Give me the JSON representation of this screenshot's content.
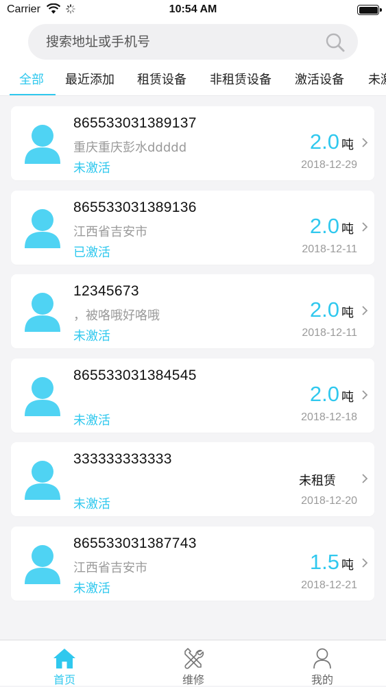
{
  "status_bar": {
    "carrier": "Carrier",
    "time": "10:54 AM"
  },
  "search": {
    "placeholder": "搜索地址或手机号"
  },
  "tabs": [
    {
      "label": "全部",
      "active": true
    },
    {
      "label": "最近添加",
      "active": false
    },
    {
      "label": "租赁设备",
      "active": false
    },
    {
      "label": "非租赁设备",
      "active": false
    },
    {
      "label": "激活设备",
      "active": false
    },
    {
      "label": "未激",
      "active": false
    }
  ],
  "devices": [
    {
      "id": "865533031389137",
      "address": "重庆重庆彭水ddddd",
      "status": "未激活",
      "weight": "2.0",
      "unit": "吨",
      "date": "2018-12-29"
    },
    {
      "id": "865533031389136",
      "address": "江西省吉安市",
      "status": "已激活",
      "weight": "2.0",
      "unit": "吨",
      "date": "2018-12-11"
    },
    {
      "id": "12345673",
      "address": "，被咯哦好咯哦",
      "status": "未激活",
      "weight": "2.0",
      "unit": "吨",
      "date": "2018-12-11"
    },
    {
      "id": "865533031384545",
      "address": "",
      "status": "未激活",
      "weight": "2.0",
      "unit": "吨",
      "date": "2018-12-18"
    },
    {
      "id": "333333333333",
      "address": "",
      "status": "未激活",
      "rental_status": "未租赁",
      "date": "2018-12-20"
    },
    {
      "id": "865533031387743",
      "address": "江西省吉安市",
      "status": "未激活",
      "weight": "1.5",
      "unit": "吨",
      "date": "2018-12-21"
    }
  ],
  "tabbar": [
    {
      "label": "首页",
      "icon": "home-icon",
      "active": true
    },
    {
      "label": "维修",
      "icon": "repair-tools-icon",
      "active": false
    },
    {
      "label": "我的",
      "icon": "profile-icon",
      "active": false
    }
  ],
  "colors": {
    "accent": "#30c8ee",
    "background": "#f4f4f6",
    "secondary_text": "#9a9a9a"
  }
}
